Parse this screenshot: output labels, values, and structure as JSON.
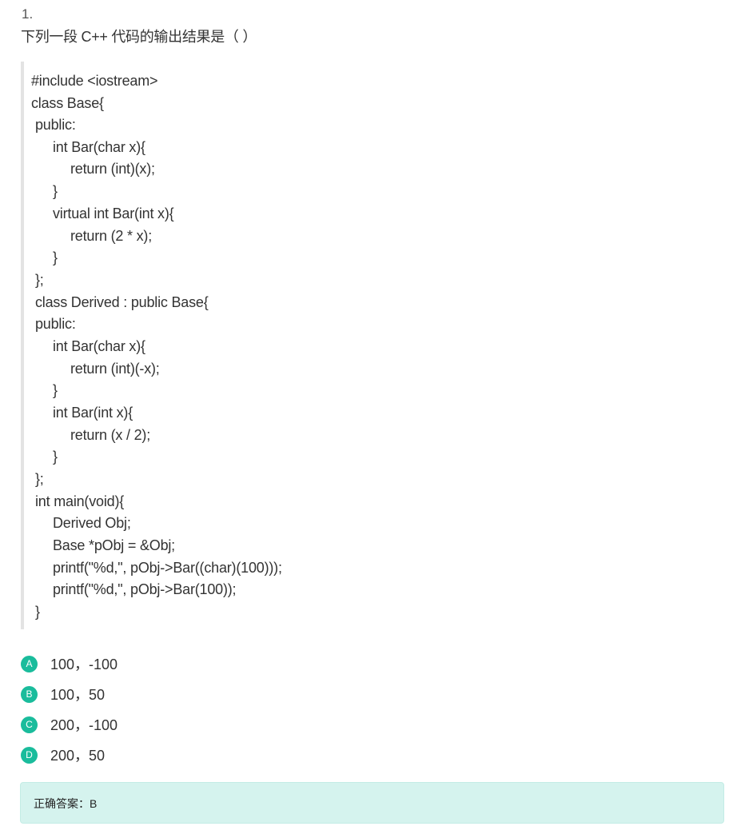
{
  "question": {
    "number": "1.",
    "text": "下列一段 C++ 代码的输出结果是（  ）"
  },
  "code_lines": [
    "#include <iostream>",
    "class Base{",
    "public:",
    "int Bar(char x){",
    "return (int)(x);",
    "}",
    "virtual int Bar(int x){",
    "return (2 * x);",
    "}",
    "};",
    "class Derived : public Base{",
    "public:",
    "int Bar(char x){",
    "return (int)(-x);",
    "}",
    "int Bar(int x){",
    "return (x / 2);",
    "}",
    "};",
    "int main(void){",
    "Derived Obj;",
    "Base *pObj = &Obj;",
    "printf(\"%d,\", pObj->Bar((char)(100)));",
    "printf(\"%d,\", pObj->Bar(100));",
    "}"
  ],
  "options": [
    {
      "letter": "A",
      "text": "100，-100"
    },
    {
      "letter": "B",
      "text": "100，50"
    },
    {
      "letter": "C",
      "text": "200，-100"
    },
    {
      "letter": "D",
      "text": "200，50"
    }
  ],
  "answer": {
    "text": "正确答案：B"
  },
  "colors": {
    "badge": "#1abc9c",
    "answer_bg": "#d5f3ee",
    "code_border": "#e3e3e3"
  }
}
